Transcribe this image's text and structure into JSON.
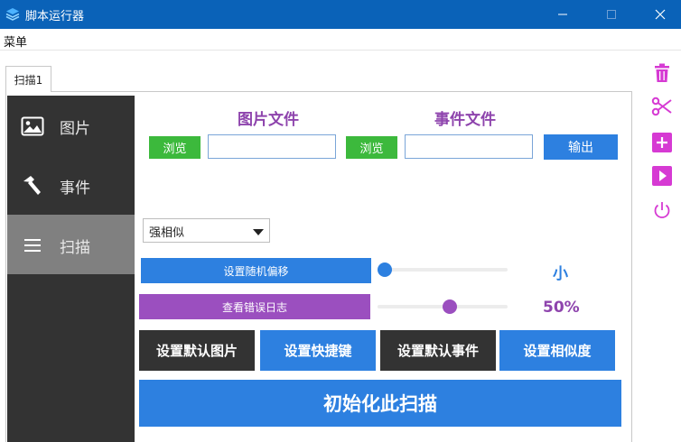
{
  "window": {
    "title": "脚本运行器"
  },
  "menu": {
    "items": [
      "菜单"
    ]
  },
  "tabs": [
    {
      "label": "扫描1"
    }
  ],
  "sidebar": {
    "items": [
      {
        "label": "图片",
        "icon": "image-icon",
        "active": false
      },
      {
        "label": "事件",
        "icon": "hammer-icon",
        "active": false
      },
      {
        "label": "扫描",
        "icon": "menu-lines-icon",
        "active": true
      }
    ]
  },
  "main": {
    "image_file": {
      "title": "图片文件",
      "browse_label": "浏览",
      "value": ""
    },
    "event_file": {
      "title": "事件文件",
      "browse_label": "浏览",
      "value": ""
    },
    "output_label": "输出",
    "similarity_select": {
      "selected": "强相似"
    },
    "random_offset": {
      "button_label": "设置随机偏移",
      "value_label": "小",
      "level": 0
    },
    "error_log": {
      "button_label": "查看错误日志",
      "value_label": "50%",
      "level": 0.5
    },
    "action_buttons": [
      "设置默认图片",
      "设置快捷键",
      "设置默认事件",
      "设置相似度"
    ],
    "init_button_label": "初始化此扫描"
  },
  "toolbar": {
    "tools": [
      "trash-icon",
      "scissors-icon",
      "plus-icon",
      "play-icon",
      "power-icon"
    ]
  },
  "colors": {
    "titlebar": "#0a62b8",
    "accent_blue": "#2d80e0",
    "green": "#3cb93c",
    "purple": "#8e44ad",
    "magenta": "#d63ad3",
    "sidebar_bg": "#333333",
    "sidebar_active": "#808080",
    "dark_button": "#333333"
  }
}
